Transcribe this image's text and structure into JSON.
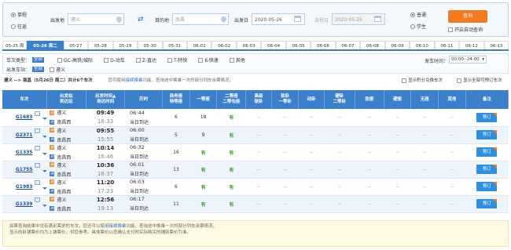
{
  "search": {
    "trip_types": [
      {
        "label": "单程",
        "selected": true
      },
      {
        "label": "往返",
        "selected": false
      }
    ],
    "from_label": "出发地",
    "from_value": "遵义",
    "to_label": "目的地",
    "to_value": "南昌",
    "date_label": "出发日",
    "date_value": "2020-05-26",
    "return_label": "返程日",
    "return_value": "2020-05-25",
    "passenger_types": [
      {
        "label": "普通",
        "selected": true
      },
      {
        "label": "学生",
        "selected": false
      }
    ],
    "query_button": "查询",
    "auto_query_label": "开启自动查询"
  },
  "date_tabs": [
    "05-25 周",
    "05-26 周二",
    "05-27",
    "05-28",
    "05-29",
    "05-30",
    "05-31",
    "06-01",
    "06-02",
    "06-03",
    "06-04",
    "06-05",
    "06-06",
    "06-07",
    "06-08",
    "06-09",
    "06-10",
    "06-11",
    "06-12",
    "06-13"
  ],
  "active_tab": 1,
  "filters": {
    "type_label": "车次类型：",
    "all_label": "全部",
    "types": [
      "GC-高铁/城际",
      "D-动车",
      "Z-直达",
      "T-特快",
      "K-快速",
      "其他"
    ],
    "depart_time_label": "发车时间：",
    "depart_time_value": "00:00--24:00",
    "station_label": "出发车站：",
    "stations": [
      "遵义"
    ]
  },
  "info": {
    "route": "遵义 --> 南昌（5月26日 周二）共计6个车次",
    "tip_prefix": "您可使用",
    "tip_link": "接续换乘",
    "tip_suffix": "功能，查询途中换乘一次的部分列车余票情况。",
    "show_points": "显示积分兑换车次",
    "show_all": "显示全部可预订车次"
  },
  "table": {
    "headers": [
      "车次",
      "出发站\n到达站",
      "出发时间▲\n到达时间",
      "历时",
      "商务座\n特等座",
      "一等座",
      "二等座\n二等包座",
      "高级\n软卧",
      "软卧\n一等卧",
      "动卧",
      "硬卧\n二等卧",
      "软座",
      "硬座",
      "无座",
      "其他",
      "备注"
    ],
    "rows": [
      {
        "train": "G1683",
        "from": "遵义",
        "to": "南昌西",
        "dep": "09:49",
        "arr": "16:33",
        "duration": "06:44",
        "day": "当日到达",
        "business": "6",
        "first": "18",
        "second": "有",
        "book": "预订"
      },
      {
        "train": "G2371",
        "from": "遵义",
        "to": "南昌西",
        "dep": "09:55",
        "arr": "15:55",
        "duration": "06:00",
        "day": "当日到达",
        "business": "5",
        "first": "9",
        "second": "有",
        "book": "预订"
      },
      {
        "train": "G1335",
        "from": "遵义",
        "to": "南昌西",
        "dep": "10:14",
        "arr": "16:46",
        "duration": "06:32",
        "day": "当日到达",
        "business": "16",
        "first": "有",
        "second": "有",
        "book": "预订"
      },
      {
        "train": "G1755",
        "from": "遵义",
        "to": "南昌西",
        "dep": "10:36",
        "arr": "16:37",
        "duration": "06:01",
        "day": "当日到达",
        "business": "13",
        "first": "有",
        "second": "有",
        "book": "预订"
      },
      {
        "train": "G1983",
        "from": "遵义",
        "to": "南昌西",
        "dep": "11:20",
        "arr": "17:23",
        "duration": "06:03",
        "day": "当日到达",
        "business": "6",
        "first": "有",
        "second": "有",
        "book": "预订"
      },
      {
        "train": "G1339",
        "from": "遵义",
        "to": "南昌西",
        "dep": "12:56",
        "arr": "19:13",
        "duration": "06:17",
        "day": "当日到达",
        "business": "11",
        "first": "有",
        "second": "有",
        "book": "预订"
      }
    ],
    "dash": "--"
  },
  "note": {
    "line1_prefix": "如果查询结果中没有满足需求的车次，您还可以使用",
    "line1_link": "接续换乘",
    "line1_suffix": "功能，查询途中换乘一次的部分列车余票情况。",
    "line2": "显示的卧铺票价均为上铺票价，供您参考。具体票价以您确认支付时实际购买的铺别票价为准。"
  },
  "colors": {
    "accent": "#3b80cc",
    "query": "#f47a20",
    "available": "#3a9d23"
  }
}
